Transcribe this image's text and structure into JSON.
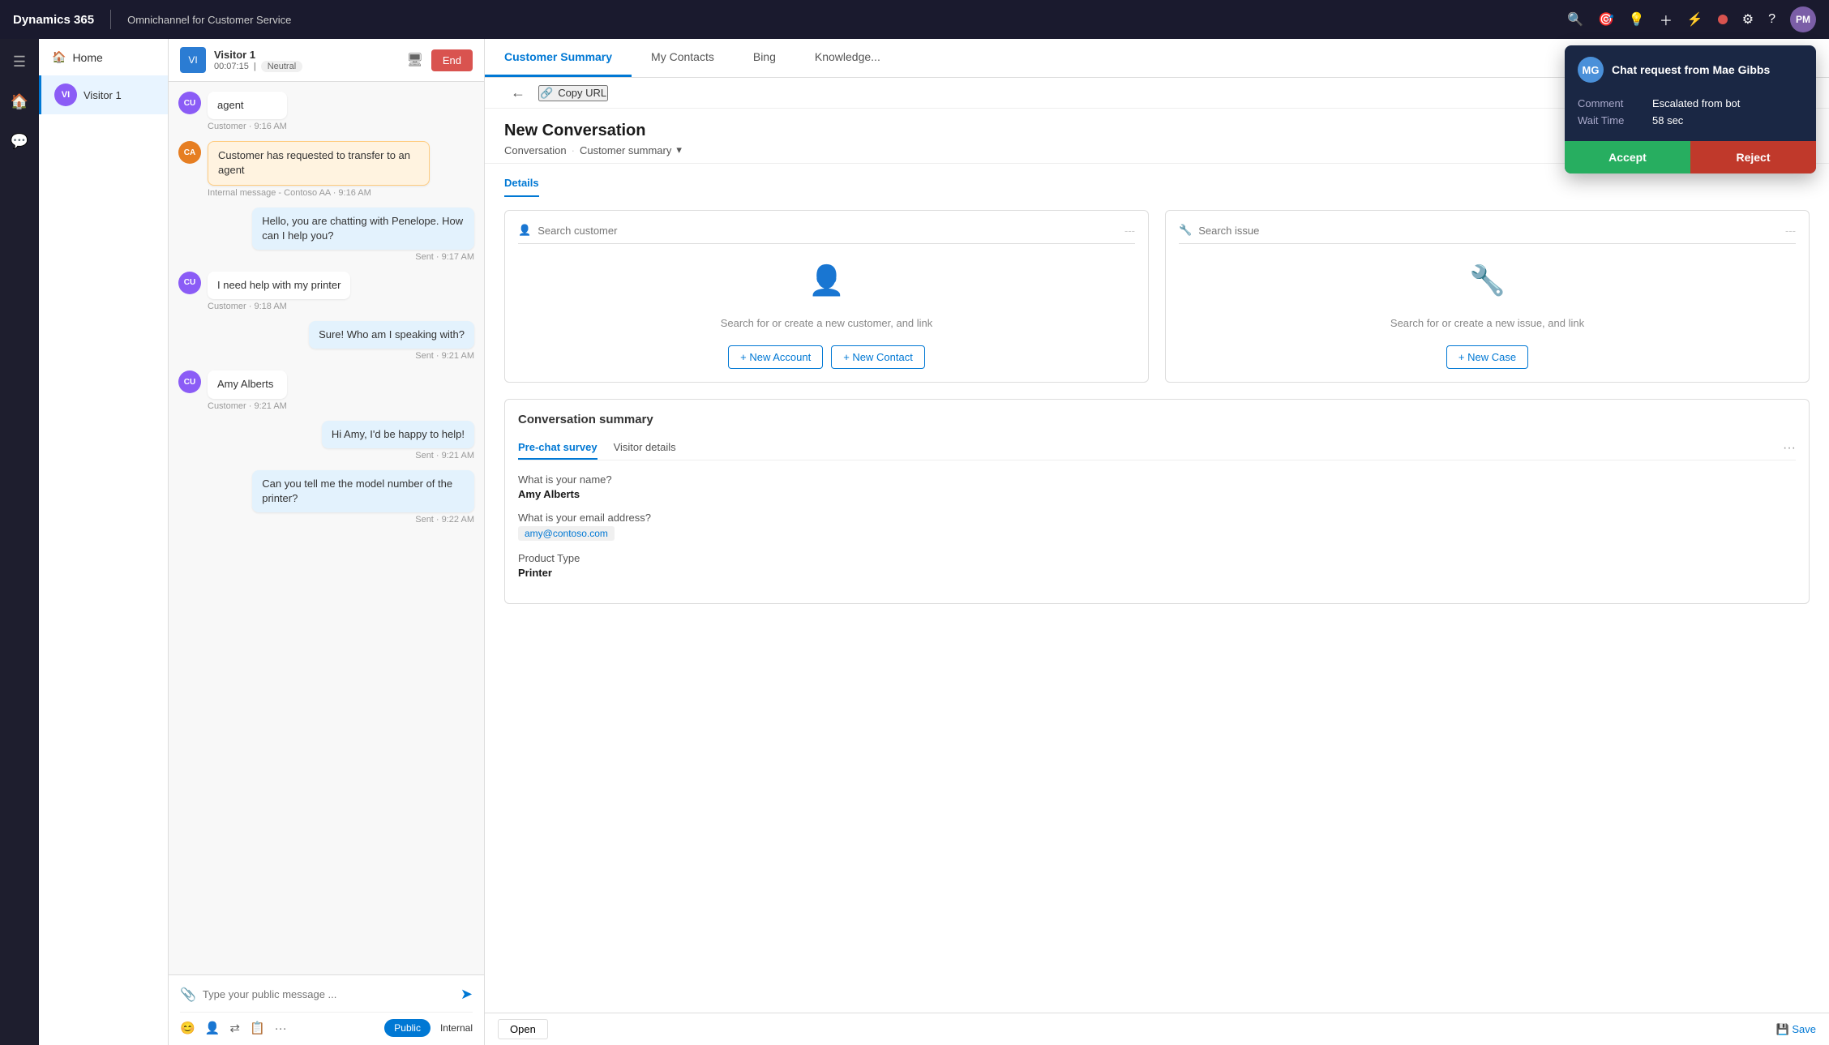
{
  "topbar": {
    "brand": "Dynamics 365",
    "app": "Omnichannel for Customer Service",
    "avatar_initials": "PM"
  },
  "sidebar": {
    "home_label": "Home"
  },
  "nav": {
    "visitor_label": "Visitor 1",
    "visitor_initials": "VI"
  },
  "conversation": {
    "header": {
      "name": "Visitor 1",
      "time": "00:07:15",
      "sentiment": "Neutral",
      "end_btn": "End"
    },
    "messages": [
      {
        "id": 1,
        "sender": "agent",
        "initials": "CU",
        "color": "#8b5cf6",
        "text": "agent",
        "time": "",
        "type": "agent"
      },
      {
        "id": 2,
        "sender": "customer",
        "initials": "CA",
        "color": "#e67e22",
        "text": "Customer has requested to transfer to an agent",
        "time": "Internal message - Contoso AA · 9:16 AM",
        "type": "internal"
      },
      {
        "id": 3,
        "sender": "sent",
        "text": "Hello, you are chatting with Penelope. How can I help you?",
        "time": "Sent · 9:17 AM",
        "type": "sent"
      },
      {
        "id": 4,
        "sender": "customer",
        "initials": "CU",
        "color": "#8b5cf6",
        "text": "I need help with my printer",
        "time": "Customer · 9:18 AM",
        "type": "customer"
      },
      {
        "id": 5,
        "sender": "sent",
        "text": "Sure! Who am I speaking with?",
        "time": "Sent · 9:21 AM",
        "type": "sent"
      },
      {
        "id": 6,
        "sender": "customer",
        "initials": "CU",
        "color": "#8b5cf6",
        "text": "Amy Alberts",
        "time": "Customer · 9:21 AM",
        "type": "customer"
      },
      {
        "id": 7,
        "sender": "sent",
        "text": "Hi Amy, I'd be happy to help!",
        "time": "Sent · 9:21 AM",
        "type": "sent"
      },
      {
        "id": 8,
        "sender": "sent",
        "text": "Can you tell me the model number of the printer?",
        "time": "Sent · 9:22 AM",
        "type": "sent"
      }
    ],
    "input_placeholder": "Type your public message ...",
    "public_btn": "Public",
    "internal_btn": "Internal"
  },
  "tabs": [
    {
      "id": "customer-summary",
      "label": "Customer Summary",
      "active": true
    },
    {
      "id": "my-contacts",
      "label": "My Contacts",
      "active": false
    },
    {
      "id": "bing",
      "label": "Bing",
      "active": false
    },
    {
      "id": "knowledge",
      "label": "Knowledge...",
      "active": false
    }
  ],
  "copy_url": "Copy URL",
  "new_conversation": {
    "title": "New Conversation",
    "breadcrumb_1": "Conversation",
    "breadcrumb_sep": "·",
    "breadcrumb_2": "Customer summary",
    "breadcrumb_chevron": "▾"
  },
  "details_tabs": [
    {
      "id": "details",
      "label": "Details",
      "active": true
    }
  ],
  "customer_search": {
    "placeholder": "Search customer",
    "placeholder_dots": "---",
    "empty_text": "Search for or create a new customer, and link",
    "new_account_btn": "+ New Account",
    "new_contact_btn": "+ New Contact"
  },
  "issue_search": {
    "placeholder": "Search issue",
    "placeholder_dots": "---",
    "empty_text": "Search for or create a new issue, and link",
    "new_case_btn": "+ New Case"
  },
  "conversation_summary": {
    "title": "Conversation summary",
    "tab1": "Pre-chat survey",
    "tab2": "Visitor details",
    "more": "···",
    "fields": [
      {
        "label": "What is your name?",
        "value": "Amy Alberts",
        "type": "text"
      },
      {
        "label": "What is your email address?",
        "value": "amy@contoso.com",
        "type": "email"
      },
      {
        "label": "Product Type",
        "value": "Printer",
        "type": "text"
      }
    ]
  },
  "chat_popup": {
    "title": "Chat request from Mae Gibbs",
    "avatar_initials": "MG",
    "comment_label": "Comment",
    "comment_value": "Escalated from bot",
    "wait_label": "Wait Time",
    "wait_value": "58 sec",
    "accept_btn": "Accept",
    "reject_btn": "Reject"
  },
  "bottom_bar": {
    "open_btn": "Open",
    "save_btn": "Save"
  }
}
